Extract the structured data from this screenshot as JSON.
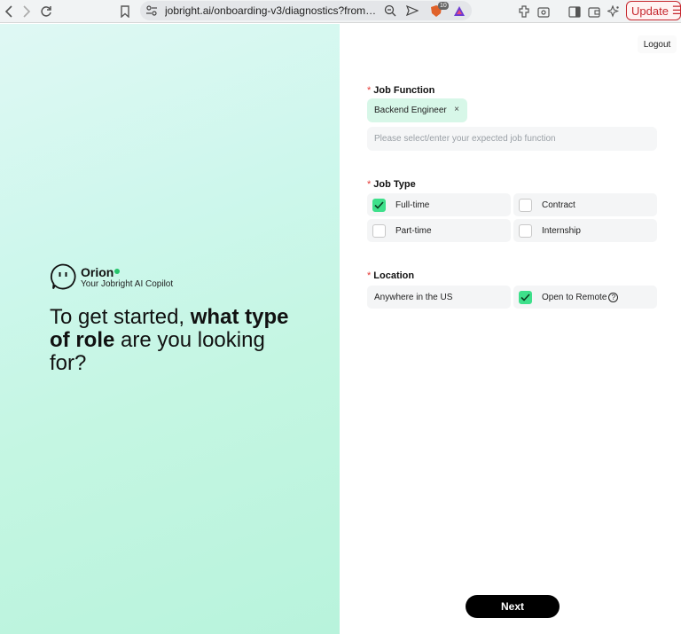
{
  "browser": {
    "url": "jobright.ai/onboarding-v3/diagnostics?from=hom...",
    "shield_badge": "10",
    "update_label": "Update"
  },
  "left": {
    "brand_name": "Orion",
    "brand_subtitle": "Your Jobright AI Copilot",
    "headline_1": "To get started, ",
    "headline_bold_1": "what type of role",
    "headline_2": " are you looking for?"
  },
  "right": {
    "logout_label": "Logout",
    "job_function": {
      "label": "Job Function",
      "selected_chip": "Backend Engineer",
      "placeholder": "Please select/enter your expected job function"
    },
    "job_type": {
      "label": "Job Type",
      "options": [
        {
          "label": "Full-time",
          "checked": true
        },
        {
          "label": "Contract",
          "checked": false
        },
        {
          "label": "Part-time",
          "checked": false
        },
        {
          "label": "Internship",
          "checked": false
        }
      ]
    },
    "location": {
      "label": "Location",
      "value": "Anywhere in the US",
      "remote_label": "Open to Remote",
      "remote_checked": true
    },
    "next_label": "Next"
  },
  "colors": {
    "accent_green": "#3ee08b",
    "chip_bg": "#d7f7e8",
    "required_red": "#e53935",
    "update_red": "#c6282f"
  }
}
